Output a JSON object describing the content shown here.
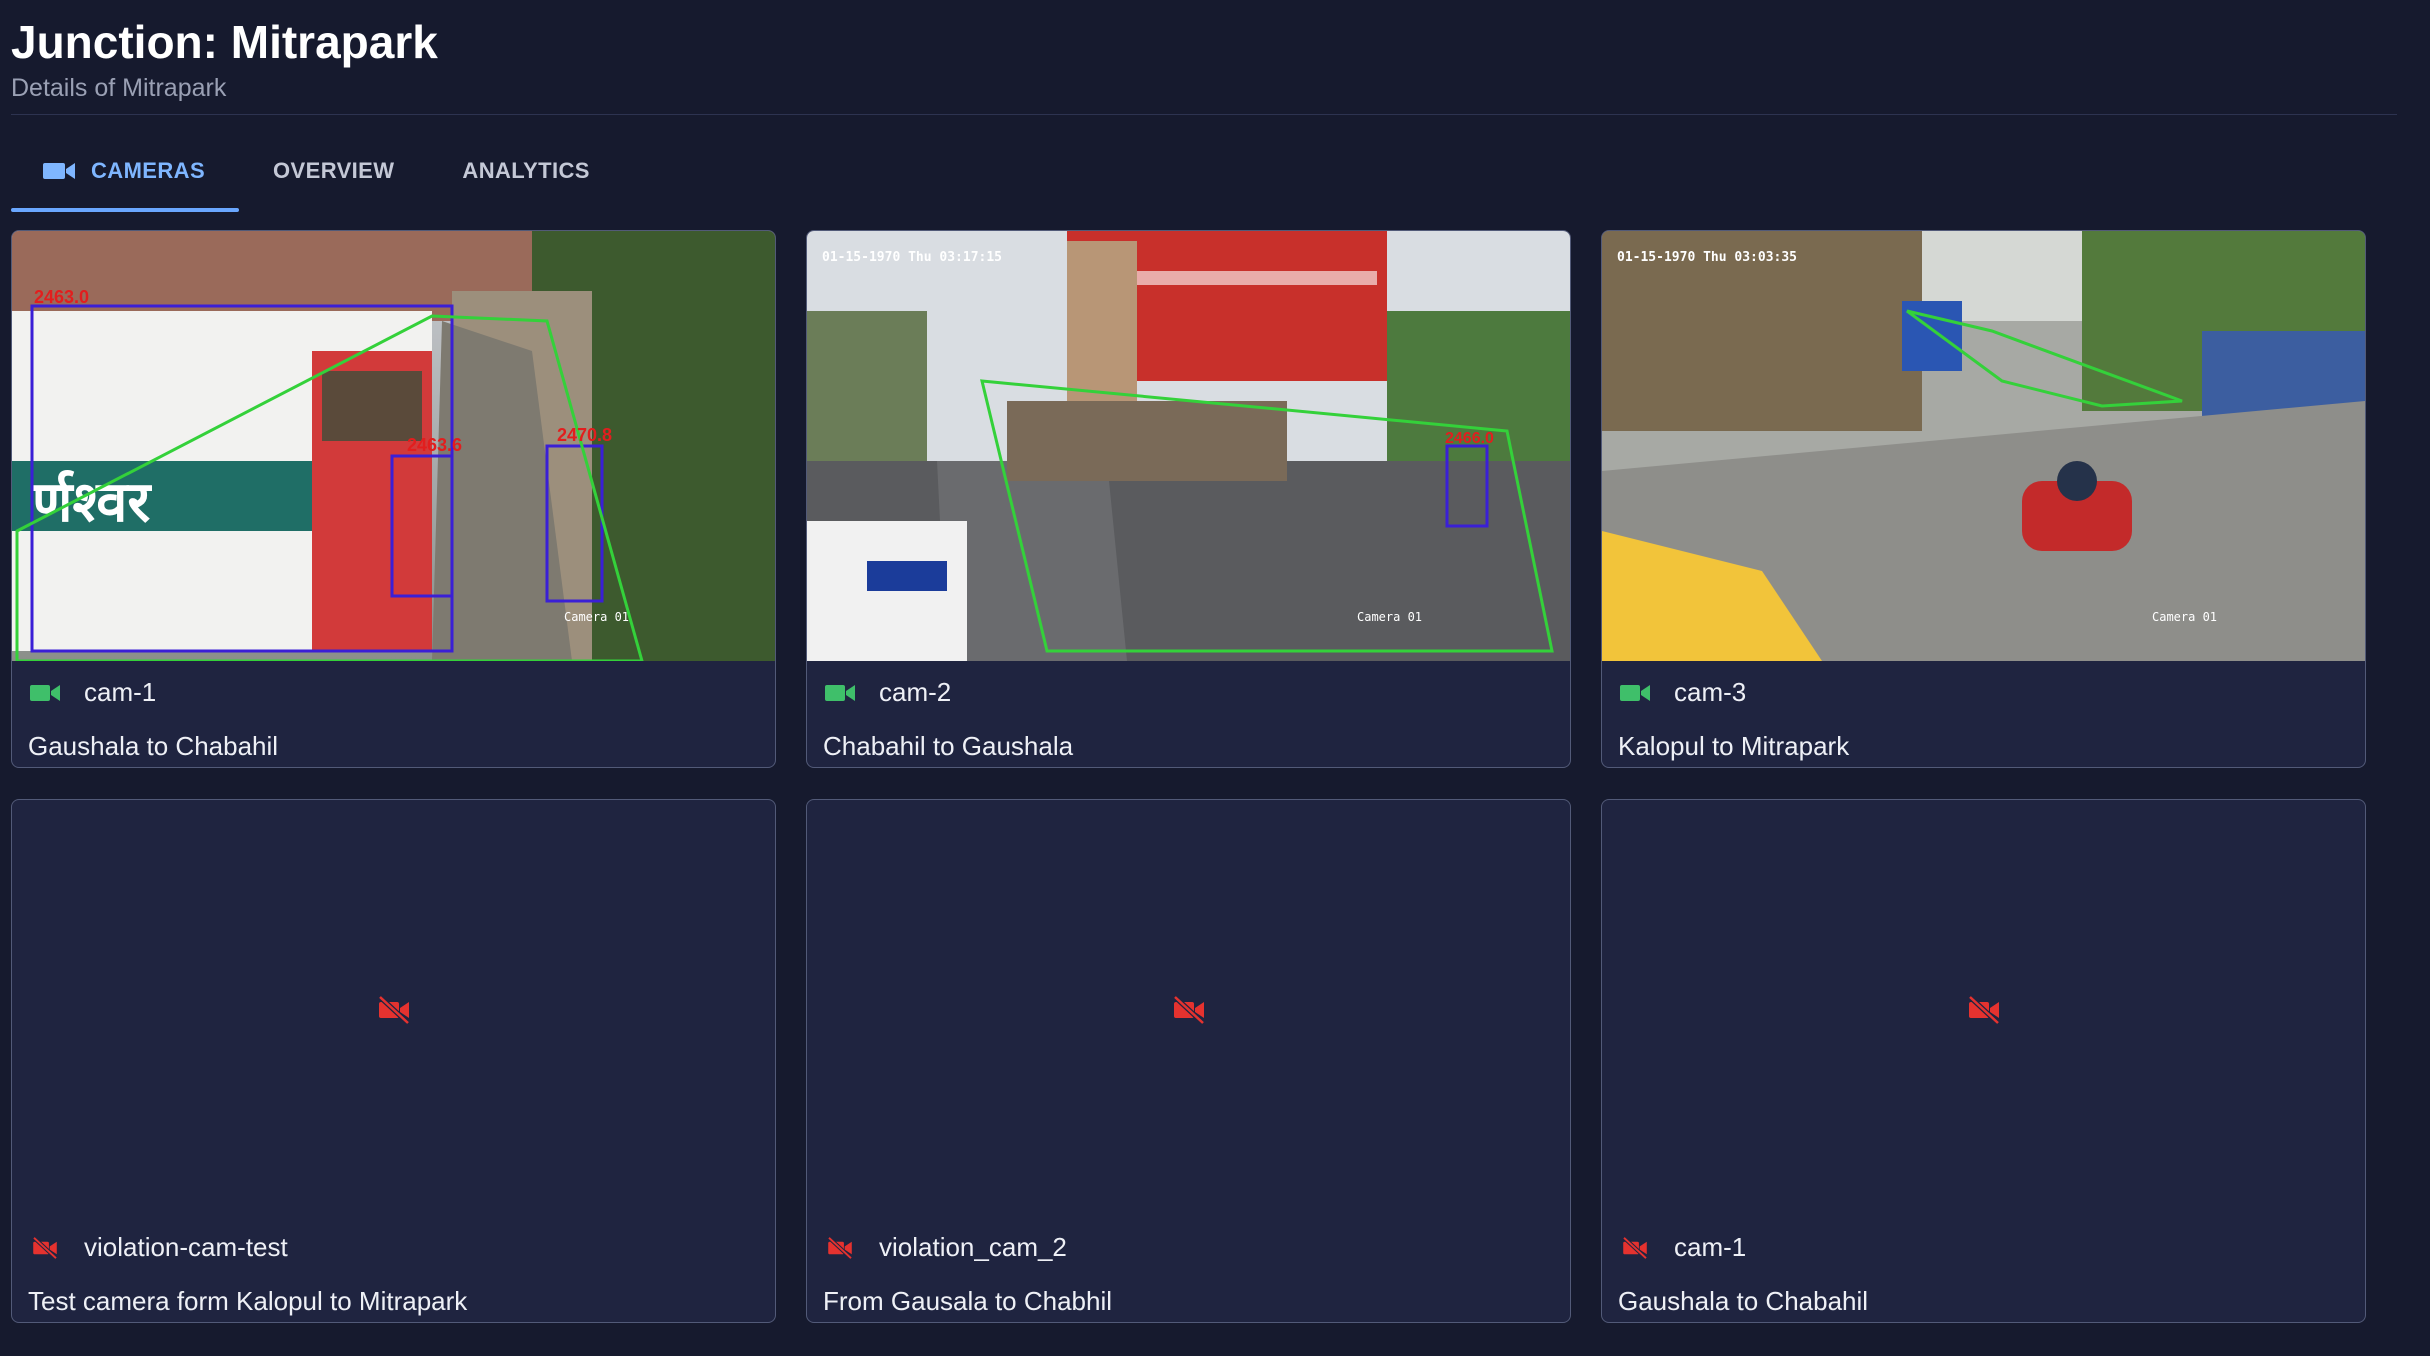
{
  "header": {
    "title": "Junction: Mitrapark",
    "subtitle": "Details of Mitrapark"
  },
  "tabs": [
    {
      "label": "CAMERAS",
      "active": true,
      "icon": "video-camera-icon"
    },
    {
      "label": "OVERVIEW",
      "active": false
    },
    {
      "label": "ANALYTICS",
      "active": false
    }
  ],
  "cameras": [
    {
      "name": "cam-1",
      "description": "Gaushala to Chabahil",
      "status": "online",
      "overlay_timestamp": "",
      "overlay_label": "Camera 01"
    },
    {
      "name": "cam-2",
      "description": "Chabahil to Gaushala",
      "status": "online",
      "overlay_timestamp": "01-15-1970 Thu 03:17:15",
      "overlay_label": "Camera 01"
    },
    {
      "name": "cam-3",
      "description": "Kalopul to Mitrapark",
      "status": "online",
      "overlay_timestamp": "01-15-1970 Thu 03:03:35",
      "overlay_label": "Camera 01"
    },
    {
      "name": "violation-cam-test",
      "description": "Test camera form Kalopul to Mitrapark",
      "status": "offline"
    },
    {
      "name": "violation_cam_2",
      "description": "From Gausala to Chabhil",
      "status": "offline"
    },
    {
      "name": "cam-1",
      "description": "Gaushala to Chabahil",
      "status": "offline"
    }
  ],
  "colors": {
    "background": "#161a2e",
    "card": "#1f2440",
    "accent": "#6aa7ff",
    "online": "#3fbf6a",
    "offline": "#e5322f"
  }
}
